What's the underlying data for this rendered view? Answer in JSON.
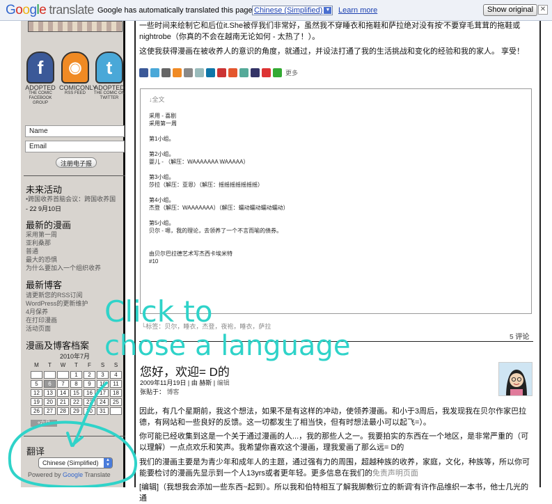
{
  "topbar": {
    "logo_google": "Google",
    "logo_translate": "translate",
    "message": "Google has automatically translated this page to:",
    "language": "Chinese (Simplified)",
    "learn_more": "Learn more",
    "show_original": "Show original",
    "close": "✕"
  },
  "sidebar": {
    "social": [
      {
        "icon": "facebook-icon",
        "glyph": "f",
        "color": "#3b5998",
        "label": "ADOPTED",
        "sub": "THE COMIC FACEBOOK GROUP"
      },
      {
        "icon": "rss-icon",
        "glyph": "◉",
        "color": "#f08a24",
        "label": "COMICONLY",
        "sub": "RSS FEED"
      },
      {
        "icon": "twitter-icon",
        "glyph": "t",
        "color": "#4aa8d8",
        "label": "ADOPTED",
        "sub": "THE COMIC ON TWITTER"
      }
    ],
    "name_placeholder": "Name",
    "email_placeholder": "Email",
    "subscribe": "注册电子报",
    "upcoming_title": "未来活动",
    "upcoming_item": "•跨国收养首脑会议：跨国收养国",
    "upcoming_date": "- 22 9月10日",
    "latest_comics_title": "最新的漫画",
    "latest_comics": [
      "采用第一周",
      "亚利桑那",
      "普通",
      "最大的恐惧",
      "为什么要加入一个组织收养"
    ],
    "latest_blog_title": "最新博客",
    "latest_blog": [
      "请更新您的RSS订阅",
      "WordPress的更新维护",
      "4月保养",
      "在打印漫画",
      "活动页面"
    ],
    "archive_title": "漫画及博客档案",
    "calendar_caption": "2010年7月",
    "calendar_days": [
      "M",
      "T",
      "W",
      "T",
      "F",
      "S",
      "S"
    ],
    "calendar_cells": [
      "",
      "",
      "",
      "1",
      "2",
      "3",
      "4",
      "5",
      "6",
      "7",
      "8",
      "9",
      "10",
      "11",
      "12",
      "13",
      "14",
      "15",
      "16",
      "17",
      "18",
      "19",
      "20",
      "21",
      "22",
      "23",
      "24",
      "25",
      "26",
      "27",
      "28",
      "29",
      "30",
      "31",
      ""
    ],
    "calendar_prev": "«六月",
    "translate_title": "翻译",
    "translate_select": "Chinese (Simplified)",
    "powered_by": "Powered by",
    "powered_google": "Google",
    "powered_translate": "Translate"
  },
  "main": {
    "intro_line1": "一些时间来绘制它和后位it.She被俘我们非常好，虽然我不穿睡衣和拖鞋和萨拉绝对没有按'不要穿毛茸茸的拖鞋或",
    "intro_line2": "nightrobe（你真的不会在越南无论如何 - 太热了！）。",
    "intro_para2": "这使我获得漫画在被收养人的意识的角度，就通过，并设法打通了我的生活挑战和变化的经验和我的家人。 享受！",
    "share_more": "更多",
    "script": {
      "fulltext": "↓全文",
      "lines": [
        "采用 - 喜剧",
        "采用第一周",
        "",
        "第1小组。",
        "",
        "第2小组。",
        "婴儿 - （解压：WAAAAAAA WAAAAA）",
        "",
        "第3小组。",
        "莎拉（解压：亚恩）（解压：摇摇摇摇摇摇摇）",
        "",
        "第4小组。",
        "杰登（解压：WAAAAAAA）（解压：蠕动蠕动蠕动蠕动）",
        "",
        "第5小组。",
        "贝尔 - 嗯，我的理论，去领养了一个不言而喻的债券。",
        "",
        "",
        "由贝尔巴拉德艺术写杰西卡埃米特",
        "#10"
      ]
    },
    "tags": "└标签：贝尔，睡衣，杰登，夜袍，睡衣，萨拉",
    "comments": "5 评论",
    "post2_title": "您好，欢迎= D的",
    "post2_date": "2009年11月19日",
    "post2_by": "| 由 赫斯 |",
    "post2_edit": "编辑",
    "post2_posted": "张贴于：",
    "post2_category": "博客",
    "post2_p1": "因此，有几个星期前，我这个想法，如果不是有这样的冲动，使领养漫画。和小于3周后，我发现我在贝尔作家巴拉德，有网站和一些良好的反馈。这一切都发生了相当快，但有时想法最小可以起飞=）。",
    "post2_p2": "你可能已经收集到这是一个关于通过漫画的人...，我的那些人之一。我要拍实的东西在一个地区，是非常严重的（可以理解）一点点欢乐和笑声。我希望你喜欢这个漫画，理我爱画了那么远= D的",
    "post2_p3": "我们的漫画主要是为青少年和成年人的主题，通过强有力的周围，超越种族的收养，家庭，文化，种族等，所以你可能要检讨的漫画先显示到一个人13yrs或者更年轻。更多信息在我们的",
    "post2_p3_link": "免责声明页面",
    "post2_p4": "[编辑]（我想我会添加一些东西~起到）。所以我和伯特相互了解我脚敷衍立的新调'有许作品维织一本书，他士几光的通"
  },
  "annotation": {
    "text_line1": "Click to",
    "text_line2": "chose a language",
    "color": "#2fd3c9"
  }
}
